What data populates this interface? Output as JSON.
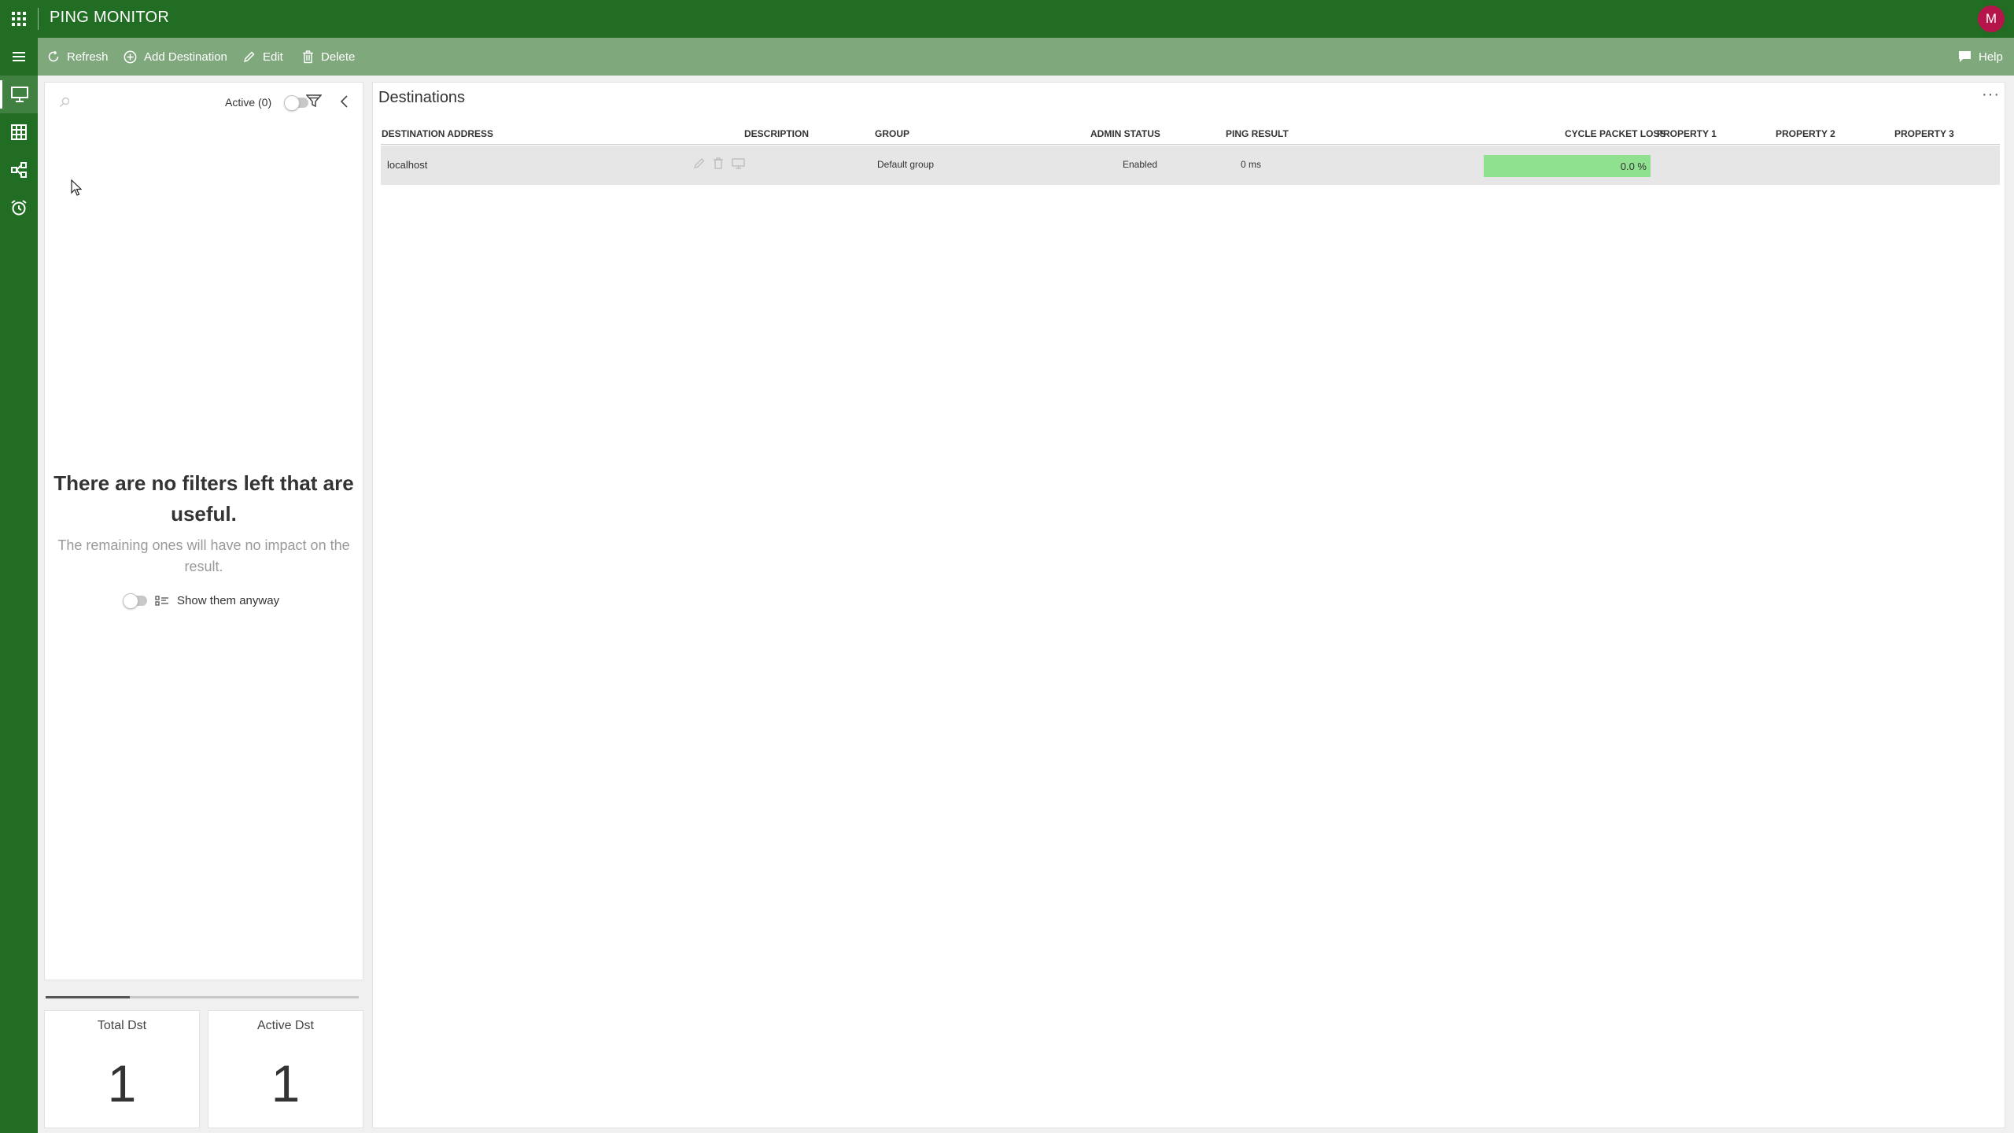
{
  "app": {
    "title": "PING MONITOR",
    "user_initial": "M"
  },
  "nav": {
    "items": [
      {
        "name": "monitor",
        "icon": "monitor-icon",
        "active": true
      },
      {
        "name": "grid",
        "icon": "grid-icon",
        "active": false
      },
      {
        "name": "topology",
        "icon": "topology-icon",
        "active": false
      },
      {
        "name": "alarms",
        "icon": "alarm-clock-icon",
        "active": false
      }
    ]
  },
  "toolbar": {
    "refresh_label": "Refresh",
    "add_label": "Add Destination",
    "edit_label": "Edit",
    "delete_label": "Delete",
    "help_label": "Help"
  },
  "filters": {
    "active_label": "Active (0)",
    "empty_title": "There are no filters left that are useful.",
    "empty_subtitle": "The remaining ones will have no impact on the result.",
    "show_anyway_label": "Show them anyway",
    "progress": 0.27
  },
  "stats": {
    "total_label": "Total Dst",
    "total_value": "1",
    "active_label": "Active Dst",
    "active_value": "1"
  },
  "destinations": {
    "title": "Destinations",
    "columns": [
      "DESTINATION ADDRESS",
      "DESCRIPTION",
      "GROUP",
      "ADMIN STATUS",
      "PING RESULT",
      "CYCLE PACKET LOSS",
      "PROPERTY 1",
      "PROPERTY 2",
      "PROPERTY 3"
    ],
    "rows": [
      {
        "address": "localhost",
        "description": "",
        "group": "Default group",
        "admin_status": "Enabled",
        "ping_result": "0 ms",
        "packet_loss": "0.0 %",
        "property1": "",
        "property2": "",
        "property3": ""
      }
    ]
  },
  "colors": {
    "header_bg": "#216d23",
    "toolbar_bg": "#80a87d",
    "avatar_bg": "#b5154b",
    "loss_bar": "#8fe08f",
    "row_bg": "#e6e6e6"
  }
}
